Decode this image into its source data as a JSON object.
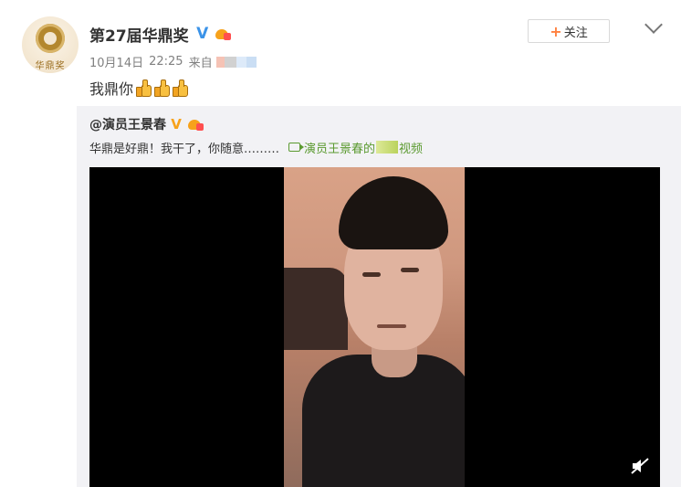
{
  "author": {
    "name": "第27届华鼎奖",
    "avatar_text": "华鼎奖",
    "badges": [
      "verified-v-icon",
      "crown-member-icon"
    ]
  },
  "meta": {
    "date": "10月14日",
    "time": "22:25",
    "from_label": "来自"
  },
  "post": {
    "text": "我鼎你",
    "emoji": [
      "thumbs-up-icon",
      "thumbs-up-icon",
      "thumbs-up-icon"
    ]
  },
  "follow_button": {
    "plus": "+",
    "label": "关注"
  },
  "repost": {
    "author": "@演员王景春",
    "text": "华鼎是好鼎！我干了，你随意………",
    "video_link_prefix": "演员王景春的",
    "video_link_suffix": "视频"
  },
  "colors": {
    "accent_orange": "#ff8140",
    "link_green": "#5b9a30",
    "verified_blue": "#3b93e8",
    "repost_bg": "#f2f2f5"
  }
}
